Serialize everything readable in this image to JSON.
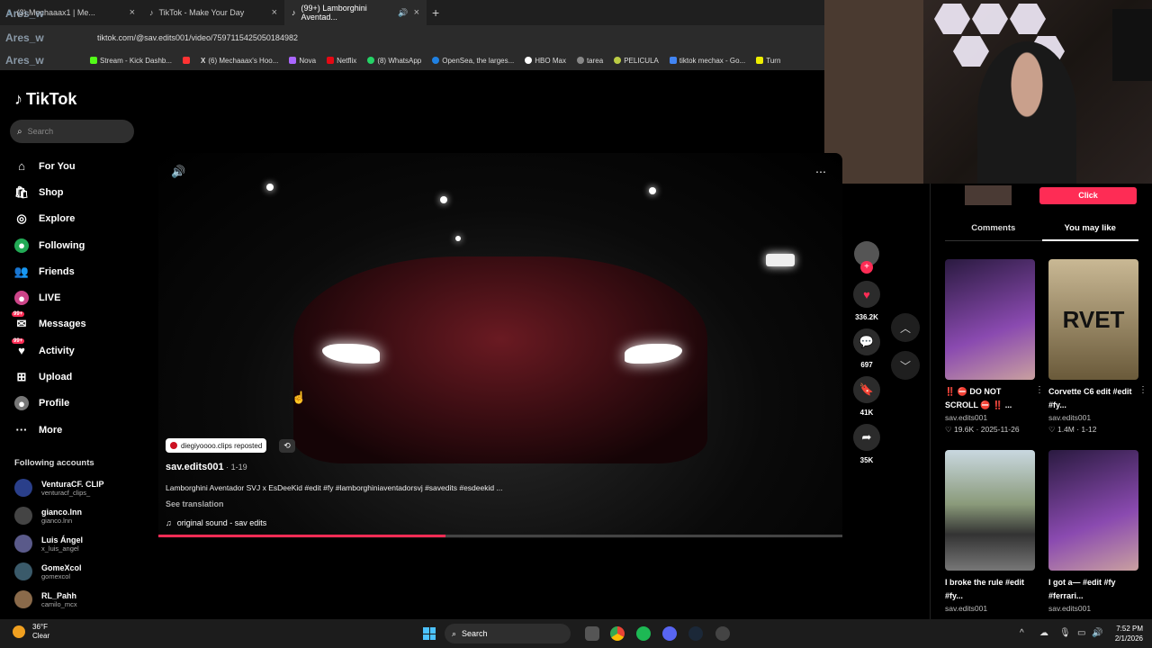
{
  "browser": {
    "tabs": [
      {
        "title": "(3) Mechaaax1 | Me..."
      },
      {
        "title": "TikTok - Make Your Day"
      },
      {
        "title": "(99+) Lamborghini Aventad..."
      }
    ],
    "new_tab": "+",
    "close": "×",
    "url": "tiktok.com/@sav.edits001/video/7597115425050184982",
    "bookmarks": [
      "k",
      "Stream - Kick Dashb...",
      "",
      "(6) Mechaaax's Hoo...",
      "Nova",
      "Netflix",
      "(8) WhatsApp",
      "OpenSea, the larges...",
      "HBO Max",
      "tarea",
      "PELICULA",
      "tiktok mechax - Go...",
      "Turn"
    ],
    "watermark": "Ares_w"
  },
  "sidebar": {
    "logo": "TikTok",
    "search_placeholder": "Search",
    "nav": [
      {
        "label": "For You",
        "icon": "home-icon"
      },
      {
        "label": "Shop",
        "icon": "shop-icon"
      },
      {
        "label": "Explore",
        "icon": "compass-icon"
      },
      {
        "label": "Following",
        "icon": "following-icon"
      },
      {
        "label": "Friends",
        "icon": "friends-icon"
      },
      {
        "label": "LIVE",
        "icon": "live-icon"
      },
      {
        "label": "Messages",
        "icon": "messages-icon",
        "badge": "99+"
      },
      {
        "label": "Activity",
        "icon": "activity-icon",
        "badge": "99+"
      },
      {
        "label": "Upload",
        "icon": "upload-icon"
      },
      {
        "label": "Profile",
        "icon": "profile-icon"
      },
      {
        "label": "More",
        "icon": "more-icon"
      }
    ],
    "following_title": "Following accounts",
    "accounts": [
      {
        "name": "VenturaCF. CLIP",
        "handle": "venturacf_clips_",
        "color": "#2a3f8a"
      },
      {
        "name": "gianco.lnn",
        "handle": "gianco.lnn",
        "color": "#444444"
      },
      {
        "name": "Luis Ángel",
        "handle": "x_luis_angel",
        "color": "#5a5a8a"
      },
      {
        "name": "GomeXcol",
        "handle": "gomexcol",
        "color": "#3a5a6a"
      },
      {
        "name": "RL_Pahh",
        "handle": "camilo_mcx",
        "color": "#8a6a4a"
      }
    ]
  },
  "video": {
    "repost_text": "diegiyoooo.clips reposted",
    "author": "sav.edits001",
    "date": " · 1-19",
    "description": "Lamborghini Aventador SVJ x EsDeeKid #edit #fy #lamborghiniaventadorsvj #savedits #esdeekid ...",
    "see_translation": "See translation",
    "sound": "original sound - sav edits",
    "progress": 0.42
  },
  "actions": {
    "likes": "336.2K",
    "comments": "697",
    "saves": "41K",
    "shares": "35K"
  },
  "right_panel": {
    "click_label": "Click",
    "tabs": [
      "Comments",
      "You may like"
    ],
    "cards": [
      {
        "title": "‼️ ⛔ DO NOT SCROLL ⛔ ‼️ ...",
        "user": "sav.edits001",
        "stats": "♡ 19.6K · 2025-11-26",
        "color": "#4a2a6a"
      },
      {
        "title": "Corvette C6 edit #edit #fy...",
        "user": "sav.edits001",
        "stats": "♡ 1.4M · 1-12",
        "color": "#8a7a5a",
        "overlay": "RVET"
      },
      {
        "title": "I broke the rule #edit #fy...",
        "user": "sav.edits001",
        "stats": "",
        "color": "#6a7a6a"
      },
      {
        "title": "I got a— #edit #fy #ferrari...",
        "user": "sav.edits001",
        "stats": "",
        "color": "#4a2a6a"
      }
    ]
  },
  "taskbar": {
    "temp": "36°F",
    "weather": "Clear",
    "search": "Search",
    "time": "7:52 PM",
    "date": "2/1/2026"
  }
}
